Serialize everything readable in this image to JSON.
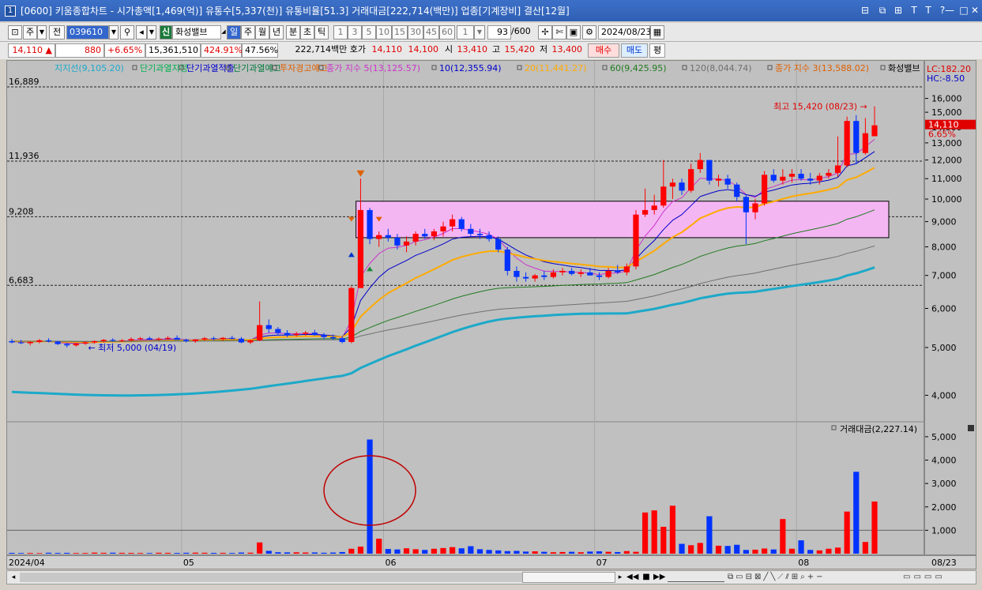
{
  "window": {
    "app_number": "1",
    "title": "[0600] 키움종합차트 - 시가총액[1,469(억)] 유통수[5,337(천)] 유통비율[51.3] 거래대금[222,714(백만)] 업종[기계장비] 결산[12월]"
  },
  "toolbar1": {
    "period_buttons": [
      "주",
      "전"
    ],
    "stock_code": "039610",
    "stock_badge": "신",
    "stock_name": "화성밸브",
    "interval_tabs": [
      "일",
      "주",
      "월",
      "년",
      "분",
      "초",
      "틱"
    ],
    "interval_selected": "일",
    "minute_options": [
      "1",
      "3",
      "5",
      "10",
      "15",
      "30",
      "45",
      "60"
    ],
    "multiplier": "1",
    "count": "93",
    "count_total": "/600",
    "date": "2024/08/23"
  },
  "quote": {
    "price": "14,110",
    "direction_arrow": "▲",
    "change": "880",
    "change_pct": "+6.65%",
    "volume": "15,361,510",
    "volume_ratio": "424.91%",
    "turnover": "47.56%",
    "amount": "222,714백만",
    "hoga_label": "호가",
    "ask": "14,110",
    "bid": "14,100",
    "open_label": "시",
    "open": "13,410",
    "high_label": "고",
    "high": "15,420",
    "low_label": "저",
    "low": "13,400",
    "buy_button": "매수",
    "sell_button": "매도",
    "avg_button": "평"
  },
  "legend": [
    {
      "label": "지지선(9,105.20)",
      "color": "#1ca9c9"
    },
    {
      "label": "단기과열지정",
      "color": "#00b050"
    },
    {
      "label": "단기과열적출",
      "color": "#0000cc"
    },
    {
      "label": "단기과열예고",
      "color": "#007a3d"
    },
    {
      "label": "투자경고예고",
      "color": "#e06000"
    },
    {
      "label": "종가 지수 5(13,125.57)",
      "color": "#cc33cc"
    },
    {
      "label": "10(12,355.94)",
      "color": "#0000cc"
    },
    {
      "label": "20(11,441.27)",
      "color": "#ffaa00"
    },
    {
      "label": "60(9,425.95)",
      "color": "#207a20"
    },
    {
      "label": "120(8,044.74)",
      "color": "#707070"
    },
    {
      "label": "종가 지수 3(13,588.02)",
      "color": "#e06000"
    },
    {
      "label": "화성밸브",
      "color": "#000000"
    }
  ],
  "right_info": {
    "lc": "LC:182.20",
    "hc": "HC:-8.50"
  },
  "price_axis": {
    "ticks": [
      "16,000",
      "15,000",
      "14,000",
      "13,000",
      "12,000",
      "11,000",
      "10,000",
      "9,000",
      "8,000",
      "7,000",
      "6,000",
      "5,000",
      "4,000"
    ],
    "current_price": "14,110",
    "current_pct": "6.65%"
  },
  "levels": [
    {
      "label": "16,889",
      "value": 16889
    },
    {
      "label": "11,936",
      "value": 11936
    },
    {
      "label": "9,208",
      "value": 9208
    },
    {
      "label": "6,683",
      "value": 6683
    }
  ],
  "annotations": {
    "high": "최고 15,420 (08/23)",
    "low": "최저 5,000 (04/19)"
  },
  "volume_panel": {
    "title": "거래대금(2,227.14)",
    "ticks": [
      "5,000",
      "4,000",
      "3,000",
      "2,000",
      "1,000"
    ]
  },
  "date_axis": {
    "labels": [
      "2024/04",
      "05",
      "06",
      "07",
      "08"
    ],
    "right_label": "08/23"
  },
  "colors": {
    "up": "#ff0000",
    "down": "#0033ff",
    "box": "#f3b6f3",
    "title_bar": "#3c70c8"
  },
  "chart_data": {
    "type": "candlestick",
    "y_scale": "log",
    "ylim": [
      3600,
      17200
    ],
    "candles": [
      {
        "o": 5150,
        "h": 5200,
        "l": 5100,
        "c": 5120
      },
      {
        "o": 5120,
        "h": 5180,
        "l": 5080,
        "c": 5100
      },
      {
        "o": 5100,
        "h": 5150,
        "l": 5050,
        "c": 5130
      },
      {
        "o": 5130,
        "h": 5200,
        "l": 5100,
        "c": 5170
      },
      {
        "o": 5170,
        "h": 5220,
        "l": 5120,
        "c": 5140
      },
      {
        "o": 5140,
        "h": 5160,
        "l": 5060,
        "c": 5080
      },
      {
        "o": 5080,
        "h": 5110,
        "l": 5000,
        "c": 5050
      },
      {
        "o": 5050,
        "h": 5110,
        "l": 5020,
        "c": 5090
      },
      {
        "o": 5090,
        "h": 5150,
        "l": 5060,
        "c": 5120
      },
      {
        "o": 5120,
        "h": 5170,
        "l": 5090,
        "c": 5150
      },
      {
        "o": 5150,
        "h": 5200,
        "l": 5120,
        "c": 5180
      },
      {
        "o": 5180,
        "h": 5220,
        "l": 5140,
        "c": 5160
      },
      {
        "o": 5160,
        "h": 5200,
        "l": 5130,
        "c": 5170
      },
      {
        "o": 5170,
        "h": 5240,
        "l": 5150,
        "c": 5200
      },
      {
        "o": 5200,
        "h": 5250,
        "l": 5170,
        "c": 5220
      },
      {
        "o": 5220,
        "h": 5260,
        "l": 5180,
        "c": 5190
      },
      {
        "o": 5190,
        "h": 5240,
        "l": 5160,
        "c": 5210
      },
      {
        "o": 5210,
        "h": 5270,
        "l": 5180,
        "c": 5230
      },
      {
        "o": 5230,
        "h": 5290,
        "l": 5200,
        "c": 5180
      },
      {
        "o": 5180,
        "h": 5210,
        "l": 5120,
        "c": 5150
      },
      {
        "o": 5150,
        "h": 5200,
        "l": 5110,
        "c": 5190
      },
      {
        "o": 5190,
        "h": 5250,
        "l": 5160,
        "c": 5220
      },
      {
        "o": 5220,
        "h": 5260,
        "l": 5170,
        "c": 5200
      },
      {
        "o": 5200,
        "h": 5250,
        "l": 5160,
        "c": 5230
      },
      {
        "o": 5230,
        "h": 5280,
        "l": 5190,
        "c": 5210
      },
      {
        "o": 5210,
        "h": 5250,
        "l": 5100,
        "c": 5120
      },
      {
        "o": 5120,
        "h": 5190,
        "l": 5080,
        "c": 5170
      },
      {
        "o": 5170,
        "h": 6200,
        "l": 5150,
        "c": 5550
      },
      {
        "o": 5550,
        "h": 5700,
        "l": 5350,
        "c": 5450
      },
      {
        "o": 5450,
        "h": 5500,
        "l": 5300,
        "c": 5350
      },
      {
        "o": 5350,
        "h": 5420,
        "l": 5250,
        "c": 5300
      },
      {
        "o": 5300,
        "h": 5380,
        "l": 5260,
        "c": 5330
      },
      {
        "o": 5330,
        "h": 5400,
        "l": 5280,
        "c": 5360
      },
      {
        "o": 5360,
        "h": 5430,
        "l": 5280,
        "c": 5300
      },
      {
        "o": 5300,
        "h": 5350,
        "l": 5200,
        "c": 5250
      },
      {
        "o": 5250,
        "h": 5310,
        "l": 5180,
        "c": 5220
      },
      {
        "o": 5220,
        "h": 5280,
        "l": 5100,
        "c": 5130
      },
      {
        "o": 5130,
        "h": 6650,
        "l": 5100,
        "c": 6600
      },
      {
        "o": 6600,
        "h": 11000,
        "l": 6600,
        "c": 9500
      },
      {
        "o": 9500,
        "h": 9600,
        "l": 8100,
        "c": 8300
      },
      {
        "o": 8300,
        "h": 8600,
        "l": 8000,
        "c": 8450
      },
      {
        "o": 8450,
        "h": 8700,
        "l": 8200,
        "c": 8350
      },
      {
        "o": 8350,
        "h": 8500,
        "l": 7900,
        "c": 8050
      },
      {
        "o": 8050,
        "h": 8400,
        "l": 7800,
        "c": 8200
      },
      {
        "o": 8200,
        "h": 8600,
        "l": 8050,
        "c": 8500
      },
      {
        "o": 8500,
        "h": 8700,
        "l": 8300,
        "c": 8400
      },
      {
        "o": 8400,
        "h": 8700,
        "l": 8250,
        "c": 8600
      },
      {
        "o": 8600,
        "h": 9000,
        "l": 8400,
        "c": 8800
      },
      {
        "o": 8800,
        "h": 9300,
        "l": 8600,
        "c": 9100
      },
      {
        "o": 9100,
        "h": 9200,
        "l": 8600,
        "c": 8700
      },
      {
        "o": 8700,
        "h": 8900,
        "l": 8400,
        "c": 8500
      },
      {
        "o": 8500,
        "h": 8700,
        "l": 8300,
        "c": 8450
      },
      {
        "o": 8450,
        "h": 8600,
        "l": 8200,
        "c": 8300
      },
      {
        "o": 8300,
        "h": 8400,
        "l": 7800,
        "c": 7900
      },
      {
        "o": 7900,
        "h": 8000,
        "l": 7000,
        "c": 7150
      },
      {
        "o": 7150,
        "h": 7300,
        "l": 6800,
        "c": 6950
      },
      {
        "o": 6950,
        "h": 7100,
        "l": 6800,
        "c": 6900
      },
      {
        "o": 6900,
        "h": 7050,
        "l": 6800,
        "c": 7000
      },
      {
        "o": 7000,
        "h": 7150,
        "l": 6850,
        "c": 6950
      },
      {
        "o": 6950,
        "h": 7200,
        "l": 6900,
        "c": 7100
      },
      {
        "o": 7100,
        "h": 7250,
        "l": 7000,
        "c": 7150
      },
      {
        "o": 7150,
        "h": 7250,
        "l": 7000,
        "c": 7050
      },
      {
        "o": 7050,
        "h": 7200,
        "l": 6950,
        "c": 7100
      },
      {
        "o": 7100,
        "h": 7250,
        "l": 7000,
        "c": 7000
      },
      {
        "o": 7000,
        "h": 7100,
        "l": 6850,
        "c": 6950
      },
      {
        "o": 6950,
        "h": 7250,
        "l": 6900,
        "c": 7150
      },
      {
        "o": 7150,
        "h": 7350,
        "l": 7050,
        "c": 7100
      },
      {
        "o": 7100,
        "h": 7400,
        "l": 7000,
        "c": 7300
      },
      {
        "o": 7300,
        "h": 9500,
        "l": 7200,
        "c": 9300
      },
      {
        "o": 9300,
        "h": 10500,
        "l": 9200,
        "c": 9500
      },
      {
        "o": 9500,
        "h": 10200,
        "l": 9300,
        "c": 9700
      },
      {
        "o": 9700,
        "h": 12000,
        "l": 9600,
        "c": 10600
      },
      {
        "o": 10600,
        "h": 11000,
        "l": 10000,
        "c": 10800
      },
      {
        "o": 10800,
        "h": 11000,
        "l": 10200,
        "c": 10400
      },
      {
        "o": 10400,
        "h": 11800,
        "l": 10300,
        "c": 11500
      },
      {
        "o": 11500,
        "h": 12400,
        "l": 11300,
        "c": 12000
      },
      {
        "o": 12000,
        "h": 12000,
        "l": 10700,
        "c": 10900
      },
      {
        "o": 10900,
        "h": 11200,
        "l": 10600,
        "c": 11000
      },
      {
        "o": 11000,
        "h": 11200,
        "l": 10500,
        "c": 10700
      },
      {
        "o": 10700,
        "h": 10800,
        "l": 9900,
        "c": 10100
      },
      {
        "o": 10100,
        "h": 10200,
        "l": 8100,
        "c": 9400
      },
      {
        "o": 9400,
        "h": 10000,
        "l": 9100,
        "c": 9800
      },
      {
        "o": 9800,
        "h": 11400,
        "l": 9700,
        "c": 11200
      },
      {
        "o": 11200,
        "h": 11500,
        "l": 10800,
        "c": 10900
      },
      {
        "o": 10900,
        "h": 11500,
        "l": 10700,
        "c": 11100
      },
      {
        "o": 11100,
        "h": 11500,
        "l": 10800,
        "c": 11250
      },
      {
        "o": 11250,
        "h": 11500,
        "l": 10900,
        "c": 11000
      },
      {
        "o": 11000,
        "h": 11300,
        "l": 10700,
        "c": 10900
      },
      {
        "o": 10900,
        "h": 11300,
        "l": 10700,
        "c": 11150
      },
      {
        "o": 11150,
        "h": 11500,
        "l": 11000,
        "c": 11300
      },
      {
        "o": 11300,
        "h": 13400,
        "l": 11100,
        "c": 11700
      },
      {
        "o": 11700,
        "h": 14700,
        "l": 11600,
        "c": 14400
      },
      {
        "o": 14400,
        "h": 14800,
        "l": 11800,
        "c": 12400
      },
      {
        "o": 12400,
        "h": 14600,
        "l": 12300,
        "c": 13600
      },
      {
        "o": 13410,
        "h": 15420,
        "l": 13400,
        "c": 14110
      }
    ],
    "volumes": [
      35,
      28,
      30,
      25,
      40,
      32,
      36,
      28,
      30,
      45,
      38,
      42,
      36,
      34,
      30,
      28,
      40,
      36,
      32,
      38,
      44,
      40,
      34,
      36,
      30,
      48,
      42,
      480,
      120,
      60,
      55,
      58,
      50,
      52,
      40,
      48,
      70,
      210,
      300,
      4880,
      640,
      200,
      180,
      230,
      190,
      160,
      210,
      240,
      280,
      230,
      320,
      190,
      160,
      140,
      110,
      120,
      90,
      100,
      80,
      60,
      70,
      80,
      60,
      90,
      100,
      80,
      70,
      110,
      80,
      1760,
      1850,
      1150,
      2050,
      420,
      360,
      460,
      1600,
      340,
      330,
      380,
      160,
      170,
      220,
      180,
      1480,
      210,
      570,
      160,
      140,
      210,
      260,
      1800,
      3500,
      500,
      2230
    ],
    "moving_averages": [
      {
        "name": "5"
      },
      {
        "name": "10"
      },
      {
        "name": "20"
      },
      {
        "name": "60"
      },
      {
        "name": "120"
      }
    ]
  }
}
